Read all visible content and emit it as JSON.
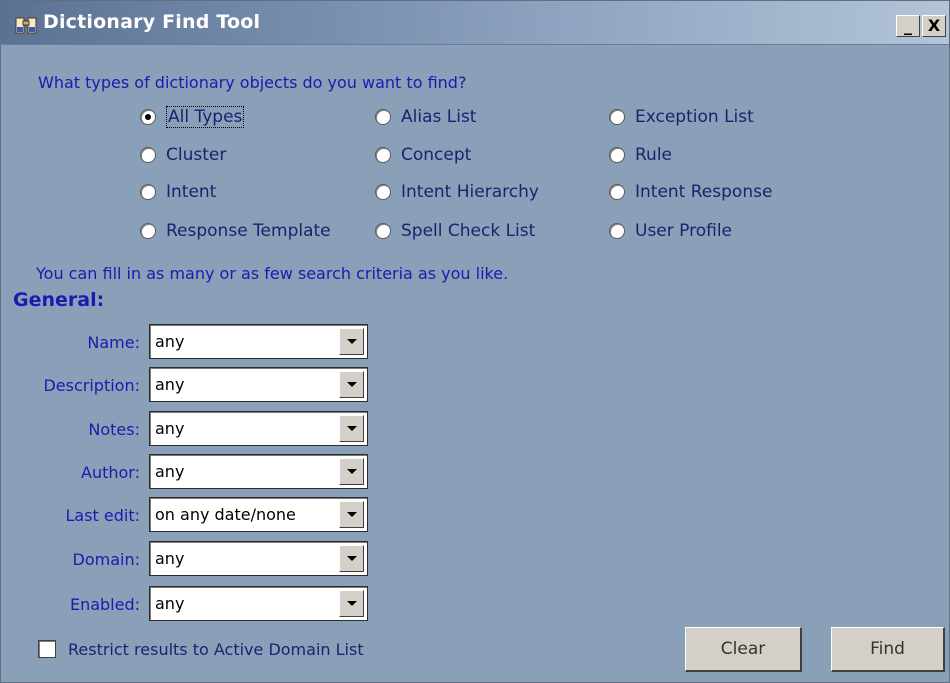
{
  "window": {
    "title": "Dictionary Find Tool",
    "minimize_label": "_",
    "close_label": "X"
  },
  "types": {
    "question": "What types of dictionary objects do you want to find?",
    "options": [
      {
        "label": "All Types",
        "checked": true
      },
      {
        "label": "Alias List",
        "checked": false
      },
      {
        "label": "Exception List",
        "checked": false
      },
      {
        "label": "Cluster",
        "checked": false
      },
      {
        "label": "Concept",
        "checked": false
      },
      {
        "label": "Rule",
        "checked": false
      },
      {
        "label": "Intent",
        "checked": false
      },
      {
        "label": "Intent Hierarchy",
        "checked": false
      },
      {
        "label": "Intent Response",
        "checked": false
      },
      {
        "label": "Response Template",
        "checked": false
      },
      {
        "label": "Spell Check List",
        "checked": false
      },
      {
        "label": "User Profile",
        "checked": false
      }
    ]
  },
  "hint": "You can fill in as many or as few search criteria as you like.",
  "general": {
    "heading": "General:",
    "fields": [
      {
        "label": "Name:",
        "value": "any"
      },
      {
        "label": "Description:",
        "value": "any"
      },
      {
        "label": "Notes:",
        "value": "any"
      },
      {
        "label": "Author:",
        "value": "any"
      },
      {
        "label": "Last edit:",
        "value": "on any date/none"
      },
      {
        "label": "Domain:",
        "value": "any"
      },
      {
        "label": "Enabled:",
        "value": "any"
      }
    ]
  },
  "footer": {
    "restrict_label": "Restrict results to Active Domain List",
    "restrict_checked": false,
    "clear_label": "Clear",
    "find_label": "Find"
  },
  "colors": {
    "background": "#8a9fb8",
    "label_blue": "#1b1bb0",
    "title_gradient_start": "#5b7292"
  }
}
